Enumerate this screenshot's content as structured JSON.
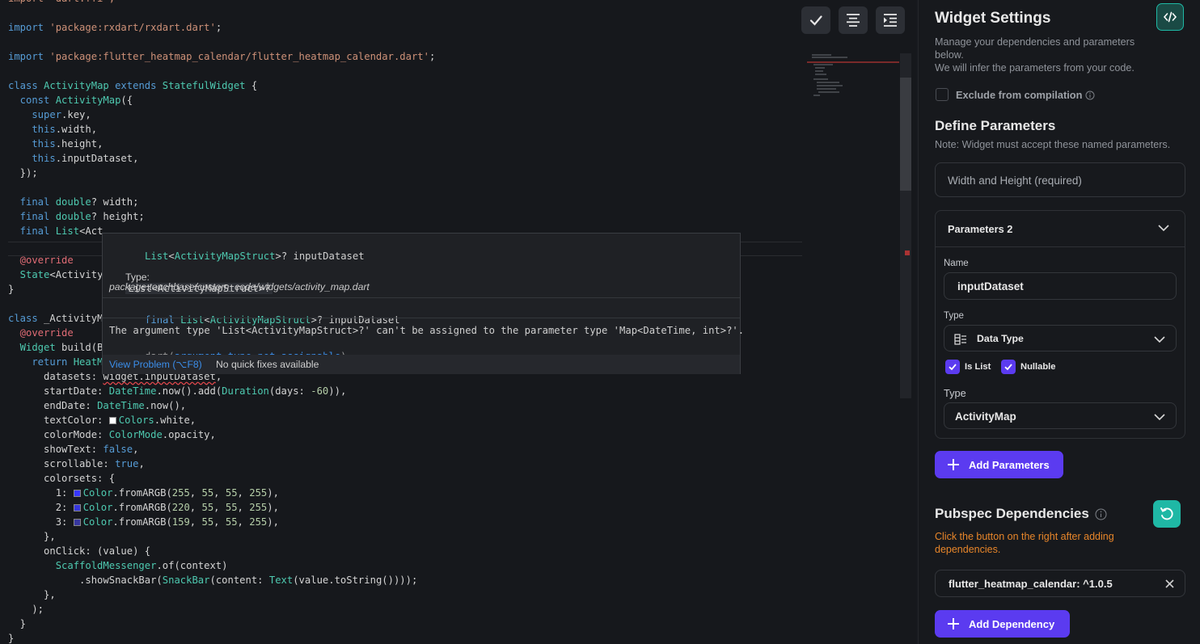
{
  "editor": {
    "lines": [
      [
        [
          "import 'dart:ffi';",
          "st"
        ]
      ],
      [
        [
          "",
          ""
        ]
      ],
      [
        [
          "import ",
          "kw"
        ],
        [
          "'package:rxdart/rxdart.dart'",
          "st"
        ],
        [
          ";",
          ""
        ]
      ],
      [
        [
          "",
          ""
        ]
      ],
      [
        [
          "import ",
          "kw"
        ],
        [
          "'package:flutter_heatmap_calendar/flutter_heatmap_calendar.dart'",
          "st"
        ],
        [
          ";",
          ""
        ]
      ],
      [
        [
          "",
          ""
        ]
      ],
      [
        [
          "class ",
          "kw"
        ],
        [
          "ActivityMap ",
          "ty"
        ],
        [
          "extends ",
          "kw"
        ],
        [
          "StatefulWidget",
          "ty"
        ],
        [
          " {",
          ""
        ]
      ],
      [
        [
          "  const ",
          "kw"
        ],
        [
          "ActivityMap",
          "ty"
        ],
        [
          "({",
          ""
        ]
      ],
      [
        [
          "    super",
          "kw"
        ],
        [
          ".key,",
          ""
        ]
      ],
      [
        [
          "    this",
          "kw"
        ],
        [
          ".width,",
          ""
        ]
      ],
      [
        [
          "    this",
          "kw"
        ],
        [
          ".height,",
          ""
        ]
      ],
      [
        [
          "    this",
          "kw"
        ],
        [
          ".inputDataset,",
          ""
        ]
      ],
      [
        [
          "  });",
          ""
        ]
      ],
      [
        [
          "",
          ""
        ]
      ],
      [
        [
          "  final ",
          "kw"
        ],
        [
          "double",
          "ty"
        ],
        [
          "? width;",
          ""
        ]
      ],
      [
        [
          "  final ",
          "kw"
        ],
        [
          "double",
          "ty"
        ],
        [
          "? height;",
          ""
        ]
      ],
      [
        [
          "  final ",
          "kw"
        ],
        [
          "List",
          "ty"
        ],
        [
          "<Act",
          ""
        ]
      ],
      [
        [
          "",
          ""
        ]
      ],
      [
        [
          "  @override",
          "an"
        ]
      ],
      [
        [
          "  State",
          "ty"
        ],
        [
          "<Activity",
          ""
        ]
      ],
      [
        [
          "}",
          ""
        ]
      ],
      [
        [
          "",
          ""
        ]
      ],
      [
        [
          "class ",
          "kw"
        ],
        [
          "_ActivityM",
          ""
        ]
      ],
      [
        [
          "  @override",
          "an"
        ]
      ],
      [
        [
          "  Widget ",
          "ty"
        ],
        [
          "build(B",
          ""
        ]
      ],
      [
        [
          "    return ",
          "kw"
        ],
        [
          "HeatM",
          "ty"
        ]
      ],
      [
        [
          "      datasets: ",
          ""
        ],
        [
          "widget.inputDataset",
          "err"
        ],
        [
          ",",
          ""
        ]
      ],
      [
        [
          "      startDate: ",
          ""
        ],
        [
          "DateTime",
          "ty"
        ],
        [
          ".now().add(",
          ""
        ],
        [
          "Duration",
          "ty"
        ],
        [
          "(days: ",
          ""
        ],
        [
          "-60",
          "nu"
        ],
        [
          ")),",
          ""
        ]
      ],
      [
        [
          "      endDate: ",
          ""
        ],
        [
          "DateTime",
          "ty"
        ],
        [
          ".now(),",
          ""
        ]
      ],
      [
        [
          "      textColor: ",
          ""
        ],
        [
          "",
          "sw:#ffffff"
        ],
        [
          "Colors",
          "ty"
        ],
        [
          ".white,",
          ""
        ]
      ],
      [
        [
          "      colorMode: ",
          ""
        ],
        [
          "ColorMode",
          "ty"
        ],
        [
          ".opacity,",
          ""
        ]
      ],
      [
        [
          "      showText: ",
          ""
        ],
        [
          "false",
          "kw"
        ],
        [
          ",",
          ""
        ]
      ],
      [
        [
          "      scrollable: ",
          ""
        ],
        [
          "true",
          "kw"
        ],
        [
          ",",
          ""
        ]
      ],
      [
        [
          "      colorsets: {",
          ""
        ]
      ],
      [
        [
          "        1: ",
          ""
        ],
        [
          "",
          "sw:#3737ff"
        ],
        [
          "Color",
          "ty"
        ],
        [
          ".fromARGB(",
          ""
        ],
        [
          "255",
          "nu"
        ],
        [
          ", ",
          ""
        ],
        [
          "55",
          "nu"
        ],
        [
          ", ",
          ""
        ],
        [
          "55",
          "nu"
        ],
        [
          ", ",
          ""
        ],
        [
          "255",
          "nu"
        ],
        [
          "),",
          ""
        ]
      ],
      [
        [
          "        2: ",
          ""
        ],
        [
          "",
          "sw:#3737dc"
        ],
        [
          "Color",
          "ty"
        ],
        [
          ".fromARGB(",
          ""
        ],
        [
          "220",
          "nu"
        ],
        [
          ", ",
          ""
        ],
        [
          "55",
          "nu"
        ],
        [
          ", ",
          ""
        ],
        [
          "55",
          "nu"
        ],
        [
          ", ",
          ""
        ],
        [
          "255",
          "nu"
        ],
        [
          "),",
          ""
        ]
      ],
      [
        [
          "        3: ",
          ""
        ],
        [
          "",
          "sw:#37379f"
        ],
        [
          "Color",
          "ty"
        ],
        [
          ".fromARGB(",
          ""
        ],
        [
          "159",
          "nu"
        ],
        [
          ", ",
          ""
        ],
        [
          "55",
          "nu"
        ],
        [
          ", ",
          ""
        ],
        [
          "55",
          "nu"
        ],
        [
          ", ",
          ""
        ],
        [
          "255",
          "nu"
        ],
        [
          "),",
          ""
        ]
      ],
      [
        [
          "      },",
          ""
        ]
      ],
      [
        [
          "      onClick: (value) {",
          ""
        ]
      ],
      [
        [
          "        ScaffoldMessenger",
          "ty"
        ],
        [
          ".of(context)",
          ""
        ]
      ],
      [
        [
          "            .showSnackBar(",
          ""
        ],
        [
          "SnackBar",
          "ty"
        ],
        [
          "(content: ",
          ""
        ],
        [
          "Text",
          "ty"
        ],
        [
          "(value.toString())));",
          ""
        ]
      ],
      [
        [
          "      },",
          ""
        ]
      ],
      [
        [
          "    );",
          ""
        ]
      ],
      [
        [
          "  }",
          ""
        ]
      ],
      [
        [
          "}",
          ""
        ]
      ]
    ],
    "toolbar": {
      "accept_icon": "check-icon",
      "format_icon": "align-center-icon",
      "indent_icon": "indent-icon"
    }
  },
  "hover": {
    "signature_type": "List",
    "signature_generic": "ActivityMapStruct",
    "signature_rest": ">? inputDataset",
    "type_label": "Type:",
    "type_value": "List<ActivityMapStruct>?",
    "package_path": "package:touchbase/custom_code/widgets/activity_map.dart",
    "decl_prefix": "final ",
    "decl_type": "List",
    "decl_generic": "ActivityMapStruct",
    "decl_rest": ">? inputDataset",
    "error_message": "The argument type 'List<ActivityMapStruct>?' can't be assigned to the parameter type 'Map<DateTime, int>?'.",
    "error_source": "dart(",
    "error_code": "argument_type_not_assignable",
    "error_close": ")",
    "view_problem": "View Problem (⌥F8)",
    "no_fixes": "No quick fixes available"
  },
  "panel": {
    "title": "Widget Settings",
    "code_icon": "code-icon",
    "description": "Manage your dependencies and parameters below.",
    "description2": "We will infer the parameters from your code.",
    "exclude_label": "Exclude from compilation",
    "define_title": "Define Parameters",
    "define_note": "Note: Widget must accept these named parameters.",
    "width_height": "Width and Height (required)",
    "params_header": "Parameters 2",
    "name_label": "Name",
    "name_value": "inputDataset",
    "type_label": "Type",
    "type_value": "Data Type",
    "is_list": "Is List",
    "nullable": "Nullable",
    "type2_label": "Type",
    "type2_value": "ActivityMap",
    "add_params": "Add Parameters",
    "pubspec_title": "Pubspec Dependencies",
    "pubspec_note": "Click the button on the right after adding dependencies.",
    "dependency": "flutter_heatmap_calendar: ^1.0.5",
    "add_dependency": "Add Dependency",
    "accent": "#5b3bf0",
    "teal": "#1fb8a5",
    "warning": "#e8862a"
  }
}
